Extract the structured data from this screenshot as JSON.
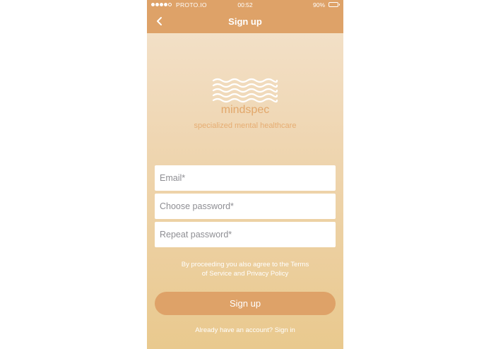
{
  "status_bar": {
    "carrier": "PROTO.IO",
    "time": "00:52",
    "battery": "90%",
    "signal_bars_filled": 4,
    "signal_bars_total": 5,
    "battery_level": 0.9
  },
  "navbar": {
    "title": "Sign up",
    "back_icon": "chevron-left-icon"
  },
  "brand": {
    "logo_icon": "waves-logo-icon",
    "name": "mindspec",
    "tagline": "specialized mental healthcare"
  },
  "form": {
    "email": {
      "value": "",
      "placeholder": "Email*"
    },
    "password": {
      "value": "",
      "placeholder": "Choose password*"
    },
    "repeat_password": {
      "value": "",
      "placeholder": "Repeat password*"
    }
  },
  "terms": {
    "line1": "By proceeding you also agree to the Terms",
    "line2": "of Service and Privacy Policy"
  },
  "actions": {
    "signup_label": "Sign up",
    "signin_text": "Already have an account? Sign in"
  },
  "colors": {
    "accent": "#dea268",
    "brand_text": "#e2a76a",
    "background_top": "#f4e3cd",
    "background_bottom": "#e9c98e"
  }
}
